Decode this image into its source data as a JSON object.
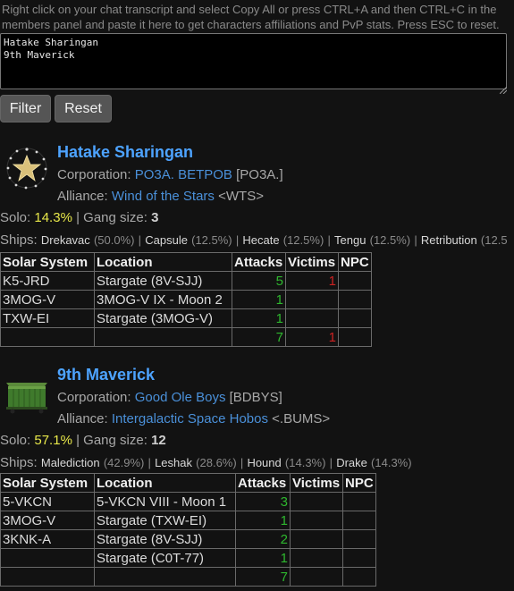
{
  "instructions": "Right click on your chat transcript and select Copy All or press CTRL+A and then CTRL+C in the members panel and paste it here to get characters affiliations and PvP stats. Press ESC to reset.",
  "transcript": "Hatake Sharingan\n9th Maverick",
  "buttons": {
    "filter": "Filter",
    "reset": "Reset"
  },
  "labels": {
    "corporation": "Corporation:",
    "alliance": "Alliance:",
    "solo": "Solo:",
    "gang": "Gang size:",
    "ships": "Ships:",
    "sep": "|"
  },
  "columns": [
    "Solar System",
    "Location",
    "Attacks",
    "Victims",
    "NPC"
  ],
  "characters": [
    {
      "name": "Hatake Sharingan",
      "portrait_icon": "star-emblem-icon",
      "corporation": "PO3A. BETPOB",
      "corp_ticker": "[PO3A.]",
      "alliance": "Wind of the Stars",
      "alliance_ticker": "<WTS>",
      "solo": "14.3%",
      "gang_size": "3",
      "ships": [
        {
          "name": "Drekavac",
          "pct": "(50.0%)"
        },
        {
          "name": "Capsule",
          "pct": "(12.5%)"
        },
        {
          "name": "Hecate",
          "pct": "(12.5%)"
        },
        {
          "name": "Tengu",
          "pct": "(12.5%)"
        },
        {
          "name": "Retribution",
          "pct": "(12.5"
        }
      ],
      "rows": [
        {
          "system": "K5-JRD",
          "location": "Stargate (8V-SJJ)",
          "attacks": "5",
          "victims": "1",
          "npc": ""
        },
        {
          "system": "3MOG-V",
          "location": "3MOG-V IX - Moon 2",
          "attacks": "1",
          "victims": "",
          "npc": ""
        },
        {
          "system": "TXW-EI",
          "location": "Stargate (3MOG-V)",
          "attacks": "1",
          "victims": "",
          "npc": ""
        }
      ],
      "totals": {
        "attacks": "7",
        "victims": "1",
        "npc": ""
      }
    },
    {
      "name": "9th Maverick",
      "portrait_icon": "green-dumpster-icon",
      "corporation": "Good Ole Boys",
      "corp_ticker": "[BDBYS]",
      "alliance": "Intergalactic Space Hobos",
      "alliance_ticker": "<.BUMS>",
      "solo": "57.1%",
      "gang_size": "12",
      "ships": [
        {
          "name": "Malediction",
          "pct": "(42.9%)"
        },
        {
          "name": "Leshak",
          "pct": "(28.6%)"
        },
        {
          "name": "Hound",
          "pct": "(14.3%)"
        },
        {
          "name": "Drake",
          "pct": "(14.3%)"
        }
      ],
      "rows": [
        {
          "system": "5-VKCN",
          "location": "5-VKCN VIII - Moon 1",
          "attacks": "3",
          "victims": "",
          "npc": ""
        },
        {
          "system": "3MOG-V",
          "location": "Stargate (TXW-EI)",
          "attacks": "1",
          "victims": "",
          "npc": ""
        },
        {
          "system": "3KNK-A",
          "location": "Stargate (8V-SJJ)",
          "attacks": "2",
          "victims": "",
          "npc": ""
        },
        {
          "system": "",
          "location": "Stargate (C0T-77)",
          "attacks": "1",
          "victims": "",
          "npc": ""
        }
      ],
      "totals": {
        "attacks": "7",
        "victims": "",
        "npc": ""
      }
    }
  ]
}
